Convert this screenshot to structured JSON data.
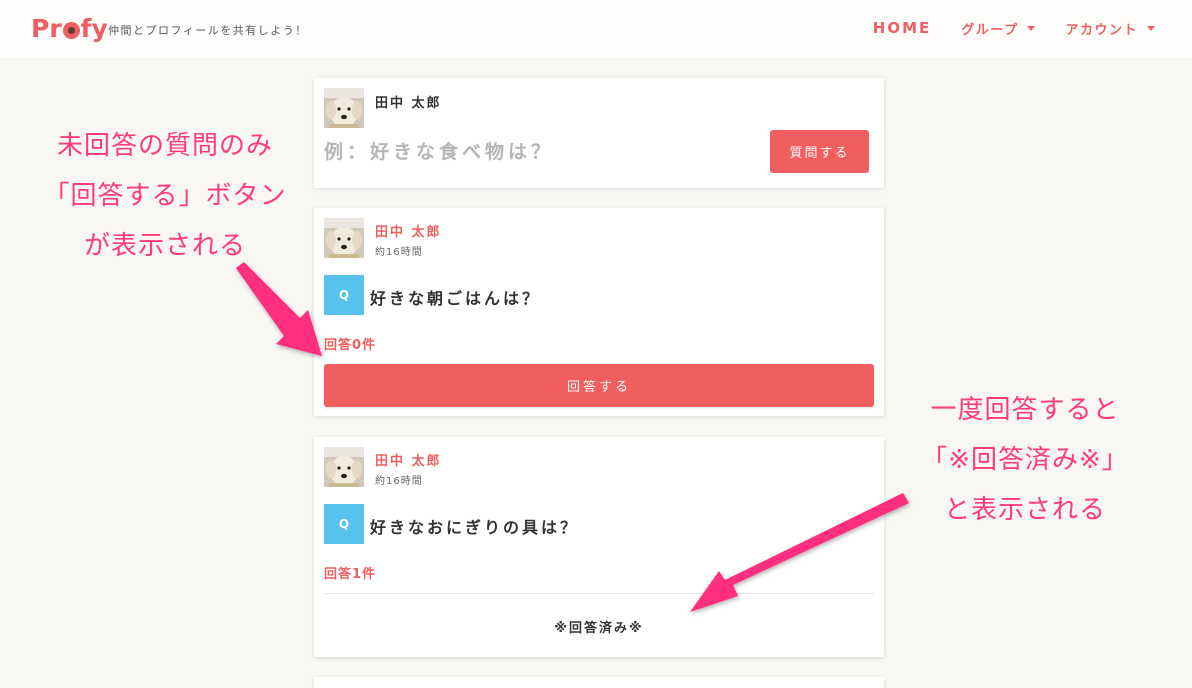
{
  "header": {
    "logo_text": "Profy",
    "tagline": "仲間とプロフィールを共有しよう！",
    "nav": [
      {
        "label": "HOME",
        "dropdown": false
      },
      {
        "label": "グループ",
        "dropdown": true
      },
      {
        "label": "アカウント",
        "dropdown": true
      }
    ]
  },
  "ask_card": {
    "user_name": "田中 太郎",
    "input_placeholder": "例：好きな食べ物は？",
    "input_value": "",
    "submit_label": "質問する"
  },
  "questions": [
    {
      "user_name": "田中 太郎",
      "time": "約16時間",
      "badge": "Q",
      "question": "好きな朝ごはんは？",
      "answer_count": "回答0件",
      "action_label": "回答する",
      "answered": false
    },
    {
      "user_name": "田中 太郎",
      "time": "約16時間",
      "badge": "Q",
      "question": "好きなおにぎりの具は？",
      "answer_count": "回答1件",
      "status_label": "※回答済み※",
      "answered": true
    }
  ],
  "annotations": {
    "left": [
      "未回答の質問のみ",
      "「回答する」ボタン",
      "が表示される"
    ],
    "right": [
      "一度回答すると",
      "「※回答済み※」",
      "と表示される"
    ]
  },
  "colors": {
    "brand": "#ef5f61",
    "question_badge": "#57c2ec",
    "annotation": "#ff3b7b",
    "background": "#f9f7f3"
  },
  "icons": {
    "avatar": "puppy-avatar",
    "nav_dropdown": "caret-down-icon"
  }
}
